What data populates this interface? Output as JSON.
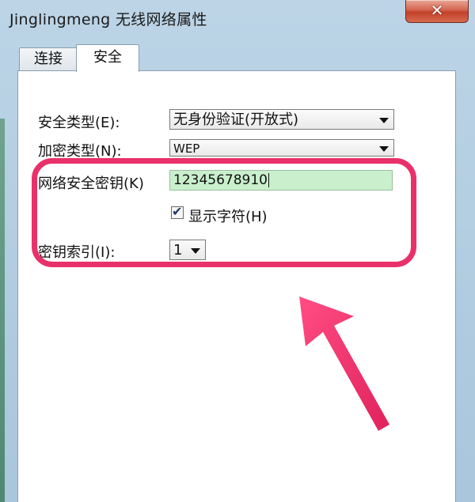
{
  "window": {
    "title": "Jinglingmeng 无线网络属性",
    "close_glyph": "✕"
  },
  "tabs": [
    {
      "label": "连接"
    },
    {
      "label": "安全"
    }
  ],
  "security": {
    "type_label": "安全类型(E):",
    "type_value": "无身份验证(开放式)",
    "encryption_label": "加密类型(N):",
    "encryption_value": "WEP",
    "key_label": "网络安全密钥(K)",
    "key_value": "12345678910",
    "show_chars_label": "显示字符(H)",
    "show_chars_checked": true,
    "key_index_label": "密钥索引(I):",
    "key_index_value": "1"
  },
  "annotation": {
    "highlight_color": "#e8316a"
  },
  "colors": {
    "key_field_bg": "#c9efcc",
    "close_button": "#c2412a"
  }
}
